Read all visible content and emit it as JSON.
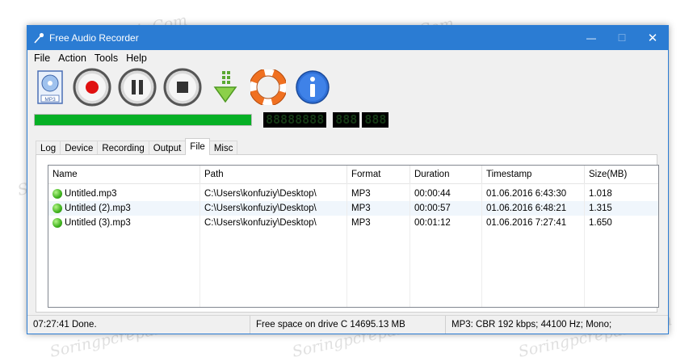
{
  "window": {
    "title": "Free Audio Recorder",
    "controls": [
      "—",
      "☐",
      "✕"
    ]
  },
  "menu": [
    "File",
    "Action",
    "Tools",
    "Help"
  ],
  "toolbar": {
    "buttons": [
      "file-mp3-icon",
      "record-icon",
      "pause-icon",
      "stop-icon",
      "download-icon",
      "help-lifebuoy-icon",
      "info-icon"
    ]
  },
  "progress": {
    "fraction": 1.0,
    "color": "#06b025"
  },
  "lcd": {
    "segment1": "88888888",
    "segment2": "888",
    "segment3": "888"
  },
  "tabs": {
    "items": [
      "Log",
      "Device",
      "Recording",
      "Output",
      "File",
      "Misc"
    ],
    "active": "File"
  },
  "file_list": {
    "columns": [
      "Name",
      "Path",
      "Format",
      "Duration",
      "Timestamp",
      "Size(MB)"
    ],
    "rows": [
      [
        "Untitled.mp3",
        "C:\\Users\\konfuziy\\Desktop\\",
        "MP3",
        "00:00:44",
        "01.06.2016 6:43:30",
        "1.018"
      ],
      [
        "Untitled (2).mp3",
        "C:\\Users\\konfuziy\\Desktop\\",
        "MP3",
        "00:00:57",
        "01.06.2016 6:48:21",
        "1.315"
      ],
      [
        "Untitled (3).mp3",
        "C:\\Users\\konfuziy\\Desktop\\",
        "MP3",
        "00:01:12",
        "01.06.2016 7:27:41",
        "1.650"
      ]
    ]
  },
  "statusbar": {
    "left": "07:27:41  Done.",
    "middle": "Free space on drive C  14695.13 MB",
    "right": "MP3:  CBR 192 kbps; 44100 Hz; Mono;"
  },
  "watermark": "Soringpcrepair.Com",
  "colors": {
    "titlebar": "#2b7cd3",
    "record": "#e01010",
    "progress": "#06b025"
  }
}
